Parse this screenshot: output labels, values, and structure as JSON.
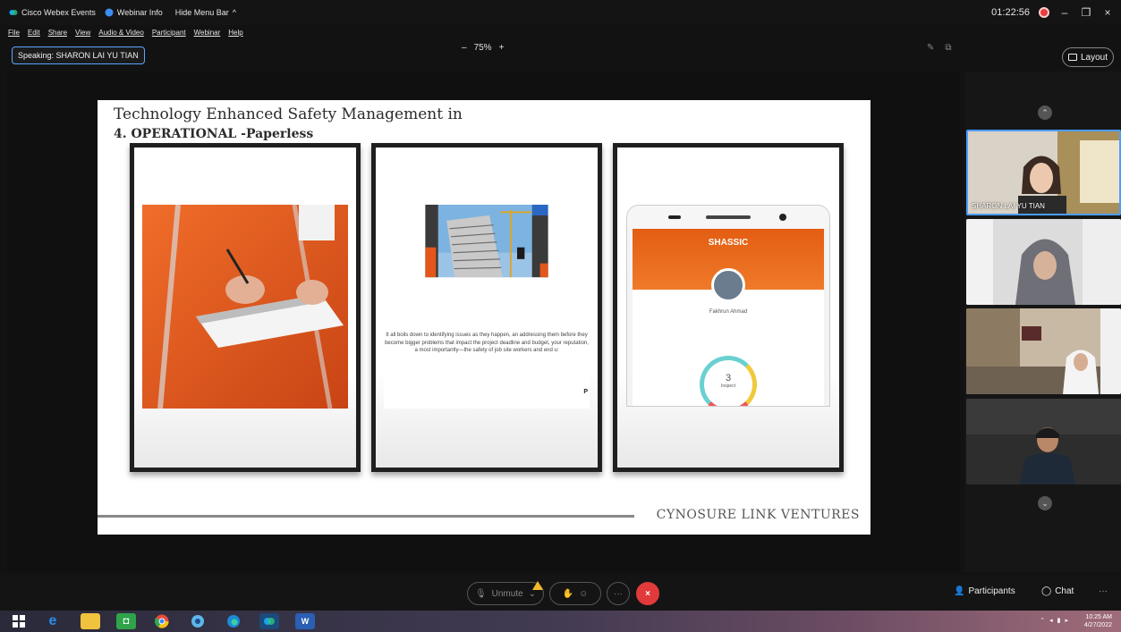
{
  "titlebar": {
    "app_name": "Cisco Webex Events",
    "webinar_info": "Webinar Info",
    "hide_menu": "Hide Menu Bar",
    "hide_menu_chevron": "^",
    "timer": "01:22:56",
    "min": "–",
    "max": "❐",
    "close": "×"
  },
  "menu": [
    "File",
    "Edit",
    "Share",
    "View",
    "Audio & Video",
    "Participant",
    "Webinar",
    "Help"
  ],
  "speaking": "Speaking: SHARON LAI YU TIAN",
  "zoom": {
    "minus": "–",
    "level": "75%",
    "plus": "+"
  },
  "layout_label": "Layout",
  "slide": {
    "title": "Technology Enhanced Safety Management in",
    "subtitle": "4. OPERATIONAL -Paperless",
    "caption": "It all boils down to identifying issues as they happen, an addressing them before they become bigger problems that impact the project deadline and budget, your reputation, a most importantly—the safety of job site workers and end u:",
    "phone_app": "SHASSIC",
    "phone_user": "Fakhrun Ahmad",
    "phone_count": "3",
    "phone_count_label": "Inspect",
    "footer": "CYNOSURE LINK VENTURES"
  },
  "participants": [
    {
      "name": "SHARON LAI YU TIAN"
    },
    {
      "name": ""
    },
    {
      "name": ""
    },
    {
      "name": ""
    }
  ],
  "controls": {
    "unmute": "Unmute",
    "participants": "Participants",
    "chat": "Chat",
    "more": "···",
    "end": "×"
  },
  "taskbar": {
    "time": "10:25 AM",
    "date": "4/27/2022"
  },
  "colors": {
    "accent": "#4b9dff",
    "end": "#e03a3a",
    "orange": "#f0641e"
  }
}
